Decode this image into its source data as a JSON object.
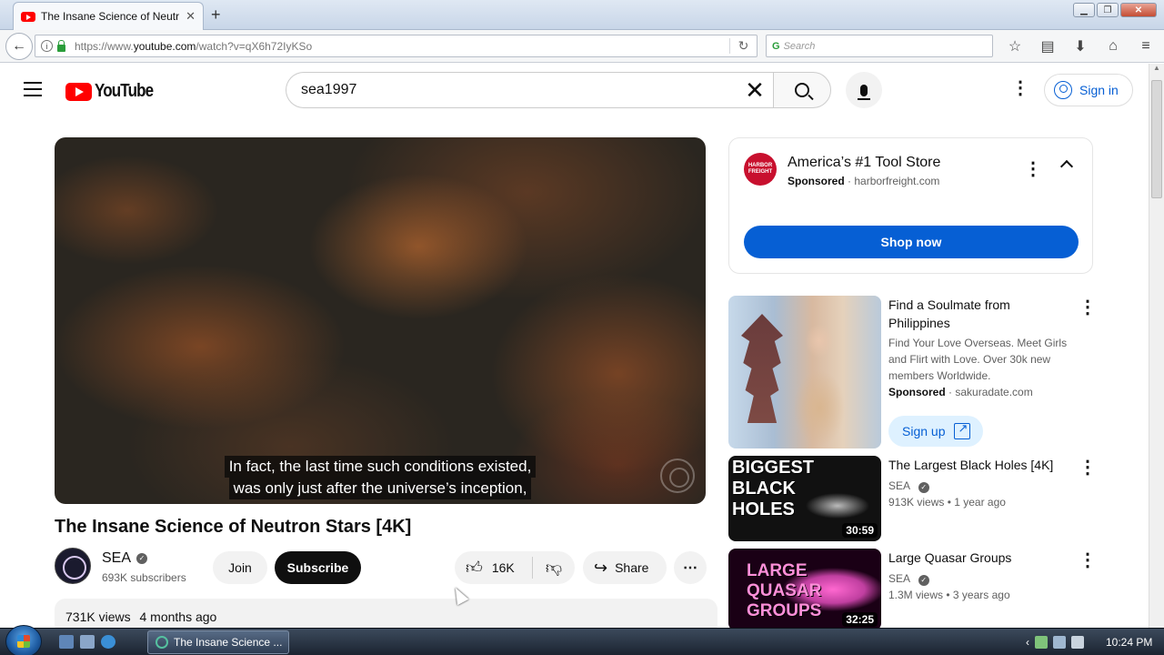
{
  "browser": {
    "tab_title": "The Insane Science of Neutr",
    "url_prefix": "https://www.",
    "url_domain": "youtube.com",
    "url_path": "/watch?v=qX6h72IyKSo",
    "search_placeholder": "Search"
  },
  "youtube": {
    "logo_text": "YouTube",
    "search_query": "sea1997",
    "signin_label": "Sign in"
  },
  "video": {
    "subtitle_line1": "In fact, the last time such conditions existed,",
    "subtitle_line2": "was only just after the universe’s inception,",
    "title": "The Insane Science of Neutron Stars [4K]",
    "channel_name": "SEA",
    "channel_subs": "693K subscribers",
    "join_label": "Join",
    "subscribe_label": "Subscribe",
    "likes": "16K",
    "share_label": "Share",
    "views": "731K views",
    "age": "4 months ago"
  },
  "ad": {
    "logo_text": "HARBOR FREIGHT",
    "title": "America’s #1 Tool Store",
    "sponsored": "Sponsored",
    "domain": "harborfreight.com",
    "cta": "Shop now"
  },
  "sidebar": {
    "items": [
      {
        "title": "Find a Soulmate from Philippines",
        "desc": "Find Your Love Overseas. Meet Girls and Flirt with Love. Over 30k new members Worldwide.",
        "sponsored": "Sponsored",
        "domain": "sakuradate.com",
        "cta": "Sign up"
      },
      {
        "title": "The Largest Black Holes [4K]",
        "thumb_text": "BIGGEST BLACK HOLES",
        "channel": "SEA",
        "views": "913K views",
        "age": "1 year ago",
        "duration": "30:59"
      },
      {
        "title": "Large Quasar Groups",
        "thumb_text": "LARGE QUASAR GROUPS",
        "channel": "SEA",
        "views": "1.3M views",
        "age": "3 years ago",
        "duration": "32:25"
      }
    ]
  },
  "taskbar": {
    "task_label": "The Insane Science ...",
    "clock": "10:24 PM"
  }
}
